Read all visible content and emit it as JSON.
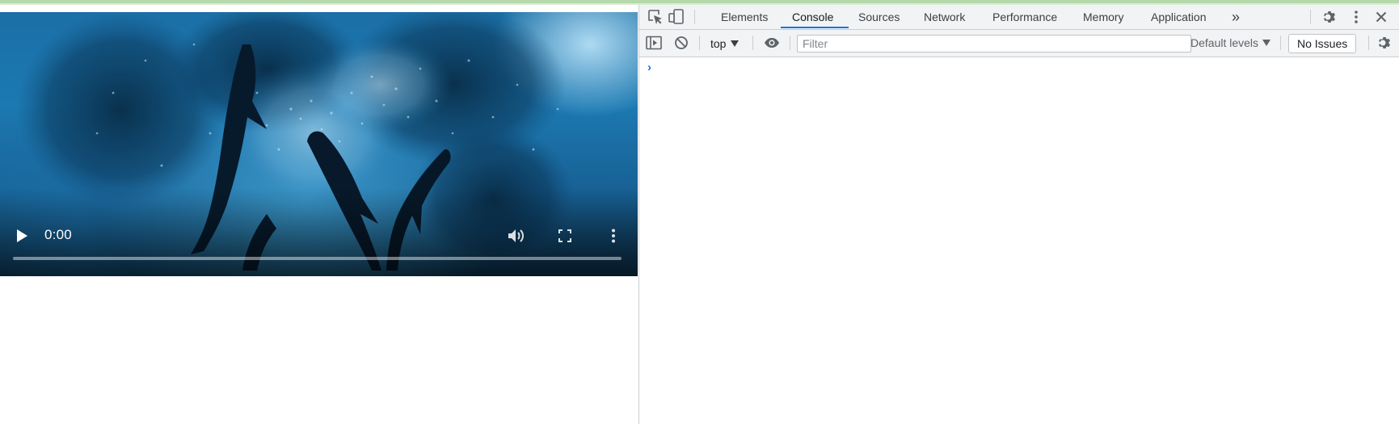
{
  "video": {
    "current_time": "0:00",
    "progress": 0,
    "icons": {
      "play": "play-icon",
      "mute": "volume-icon",
      "fullscreen": "fullscreen-icon",
      "overflow": "more-vert-icon"
    }
  },
  "devtools": {
    "tabs": [
      {
        "label": "Elements",
        "active": false
      },
      {
        "label": "Console",
        "active": true
      },
      {
        "label": "Sources",
        "active": false
      },
      {
        "label": "Network",
        "active": false
      },
      {
        "label": "Performance",
        "active": false
      },
      {
        "label": "Memory",
        "active": false
      },
      {
        "label": "Application",
        "active": false
      }
    ],
    "more_tabs_label": "»",
    "toolbar_icons": [
      "inspect-element-icon",
      "device-toolbar-icon",
      "settings-icon",
      "kebab-menu-icon",
      "close-icon"
    ],
    "console": {
      "context": "top",
      "filter_placeholder": "Filter",
      "filter_value": "",
      "levels_label": "Default levels",
      "issues_label": "No Issues",
      "prompt_symbol": "›"
    },
    "colors": {
      "accent": "#1a73e8",
      "toolbar_bg": "#f1f3f4"
    }
  }
}
